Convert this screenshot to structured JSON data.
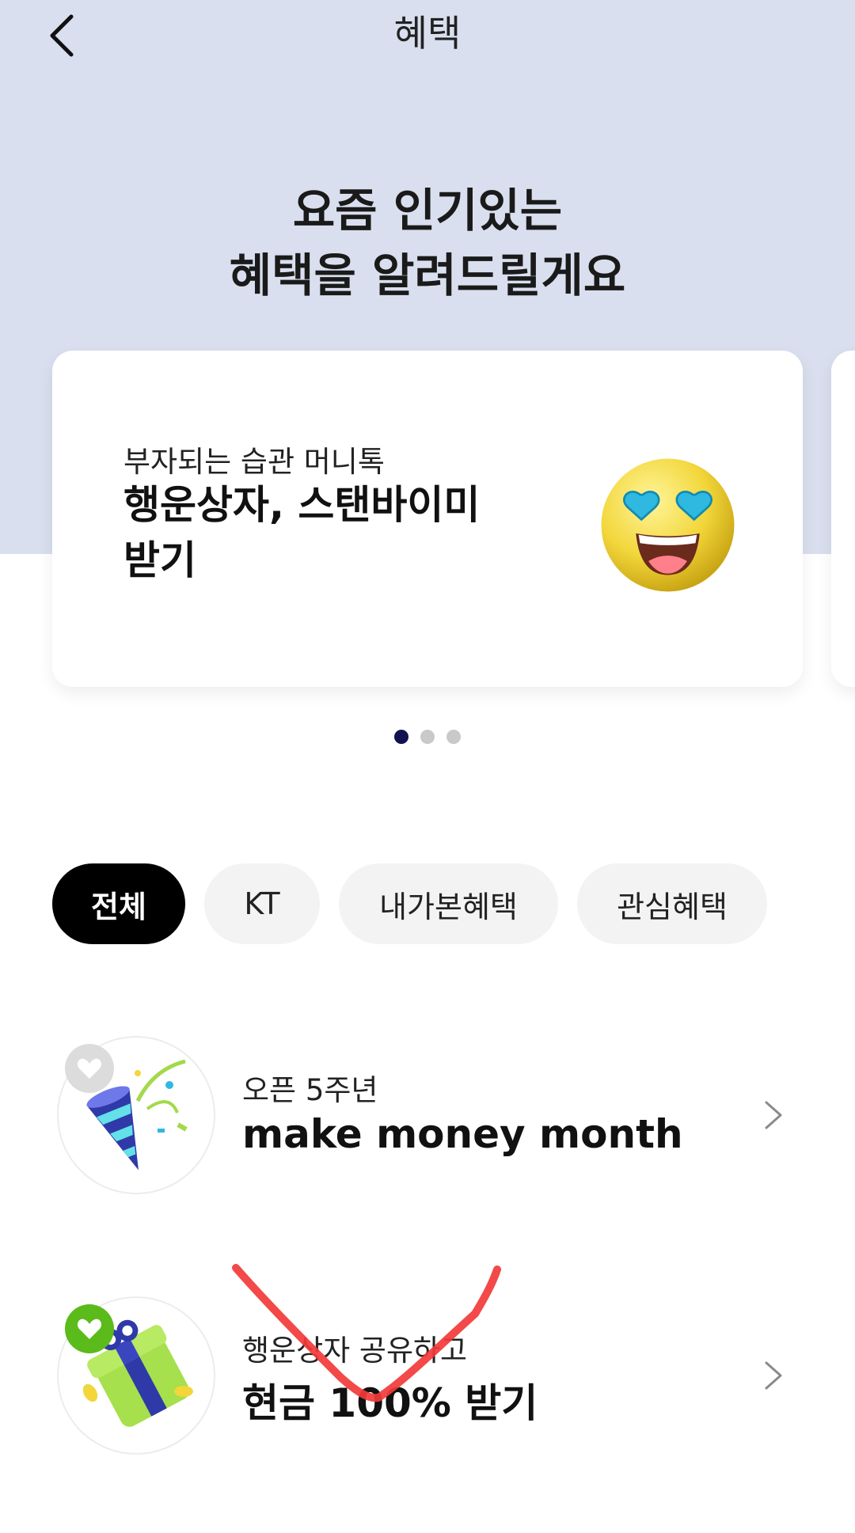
{
  "header": {
    "title": "혜택"
  },
  "hero": {
    "line1": "요즘 인기있는",
    "line2": "혜택을 알려드릴게요"
  },
  "carousel": {
    "card": {
      "subtitle": "부자되는 습관 머니톡",
      "title_line1": "행운상자, 스탠바이미",
      "title_line2": "받기",
      "icon": "heart-eyes-emoji-icon"
    },
    "total_pages": 3,
    "active_page": 1
  },
  "filters": [
    {
      "label": "전체",
      "active": true
    },
    {
      "label": "KT",
      "active": false
    },
    {
      "label": "내가본혜택",
      "active": false
    },
    {
      "label": "관심혜택",
      "active": false
    }
  ],
  "benefits": [
    {
      "subtitle": "오픈 5주년",
      "title": "make money month",
      "icon": "party-popper-icon",
      "favorite": false
    },
    {
      "subtitle": "행운상자 공유하고",
      "title": "현금 100% 받기",
      "icon": "gift-box-icon",
      "favorite": true
    }
  ],
  "colors": {
    "hero_bg": "#d9dfee",
    "active_dot": "#13124e",
    "favorite_on": "#5bbb1a",
    "annotation": "#f23a3a"
  }
}
